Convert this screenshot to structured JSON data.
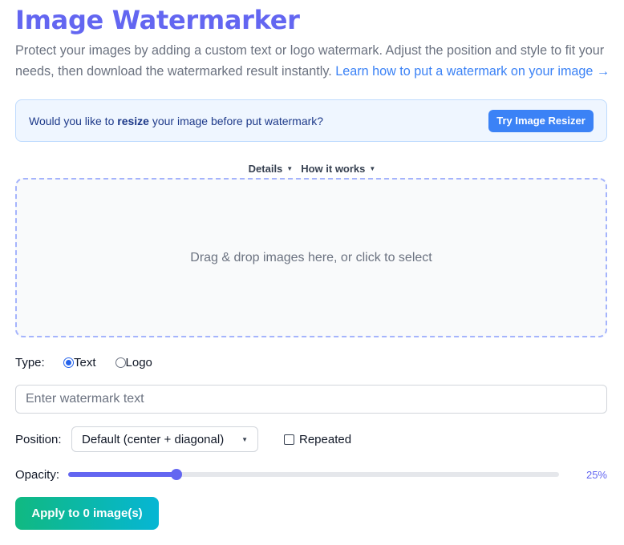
{
  "header": {
    "title": "Image Watermarker",
    "intro": "Protect your images by adding a custom text or logo watermark. Adjust the position and style to fit your needs, then download the watermarked result instantly. ",
    "learn_link": "Learn how to put a watermark on your image →"
  },
  "banner": {
    "text_before": "Would you like to ",
    "text_bold": "resize",
    "text_after": " your image before put watermark?",
    "button_label": "Try Image Resizer"
  },
  "toggles": {
    "details": "Details",
    "how_it_works": "How it works"
  },
  "dropzone": {
    "text": "Drag & drop images here, or click to select"
  },
  "type": {
    "label": "Type:",
    "options": [
      "Text",
      "Logo"
    ],
    "selected": "Text"
  },
  "watermark_input": {
    "placeholder": "Enter watermark text",
    "value": ""
  },
  "position": {
    "label": "Position:",
    "selected": "Default (center + diagonal)",
    "repeated_label": "Repeated",
    "repeated_checked": false
  },
  "opacity": {
    "label": "Opacity:",
    "value_label": "25%",
    "fraction": 0.22
  },
  "apply": {
    "label": "Apply to 0 image(s)"
  },
  "colors": {
    "accent": "#6366f1",
    "link": "#3b82f6",
    "apply_gradient_start": "#10b981",
    "apply_gradient_end": "#06b6d4"
  }
}
